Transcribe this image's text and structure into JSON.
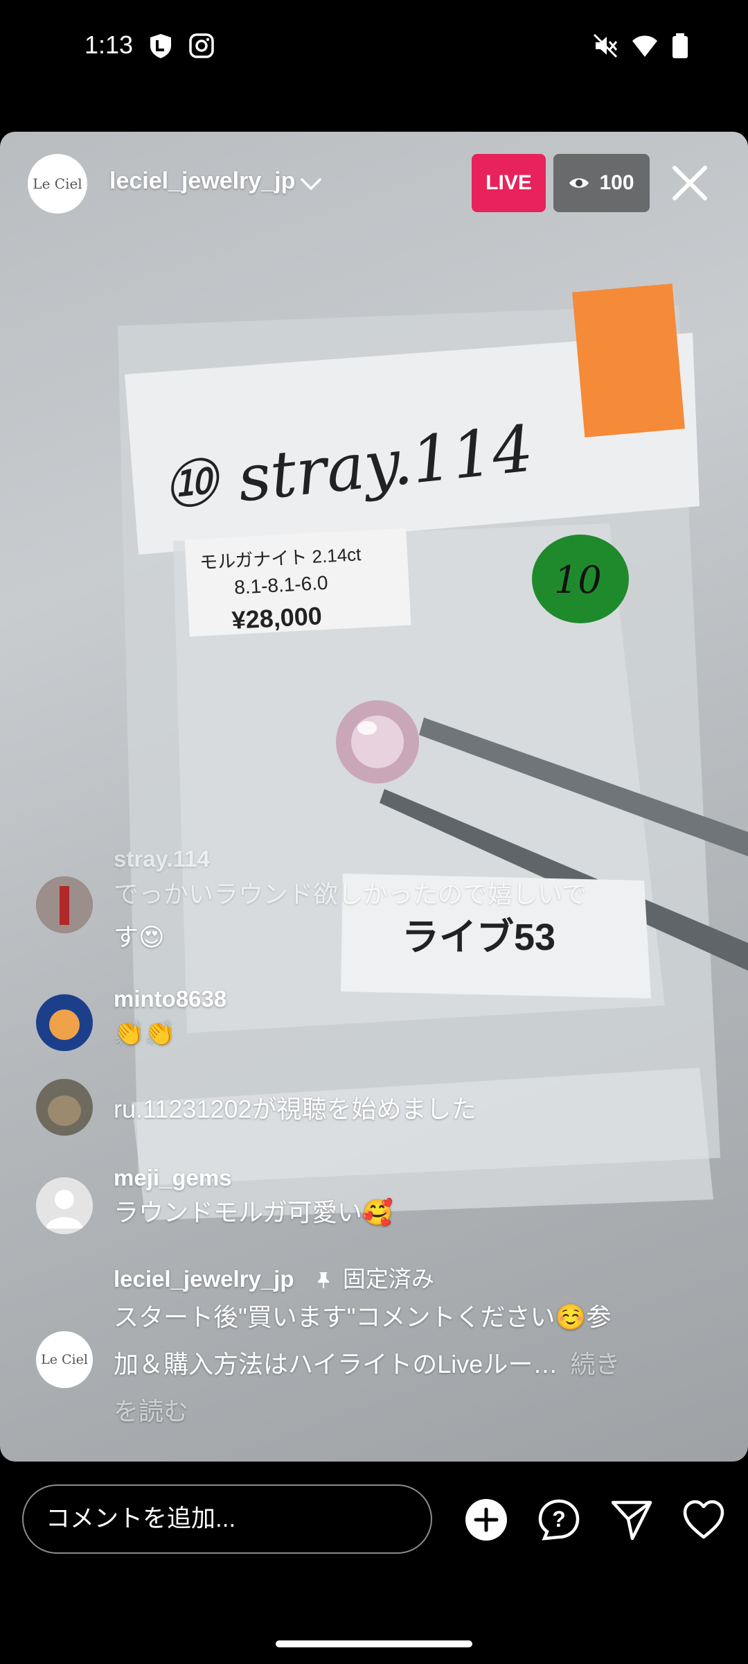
{
  "status_bar": {
    "time": "1:13"
  },
  "header": {
    "avatar_logo": "Le Ciel",
    "username": "leciel_jewelry_jp",
    "live_label": "LIVE",
    "viewer_count": "100"
  },
  "scene": {
    "handwritten_label": "⑩ stray.114",
    "price_tag_line1": "モルガナイト 2.14ct",
    "price_tag_line2": "8.1-8.1-6.0",
    "price_tag_price": "¥28,000",
    "sticker_number": "10",
    "live_tag": "ライブ53"
  },
  "comments": [
    {
      "user": "stray.114",
      "text": "でっかいラウンド欲しかったので嬉しいで",
      "text2": "す😍"
    },
    {
      "user": "minto8638",
      "text": "👏👏"
    },
    {
      "text": "ru.11231202が視聴を始めました"
    },
    {
      "user": "meji_gems",
      "text": "ラウンドモルガ可愛い🥰"
    },
    {
      "user": "leciel_jewelry_jp",
      "pinned_label": "固定済み",
      "text": "スタート後\"買います\"コメントください☺️参",
      "text2": "加＆購入方法はハイライトのLiveルー…",
      "read_more_1": "続き",
      "read_more_2": "を読む",
      "avatar_logo": "Le Ciel"
    }
  ],
  "bottom_bar": {
    "comment_placeholder": "コメントを追加..."
  },
  "colors": {
    "live": "#e8225b",
    "background": "#000000",
    "tag_orange": "#f58a38",
    "sticker_green": "#1f8a2c"
  },
  "icons": [
    "shield-icon",
    "instagram-icon",
    "mute-icon",
    "wifi-icon",
    "battery-icon",
    "chevron-down-icon",
    "eye-icon",
    "close-icon",
    "pin-icon",
    "add-icon",
    "question-icon",
    "send-icon",
    "heart-icon"
  ]
}
